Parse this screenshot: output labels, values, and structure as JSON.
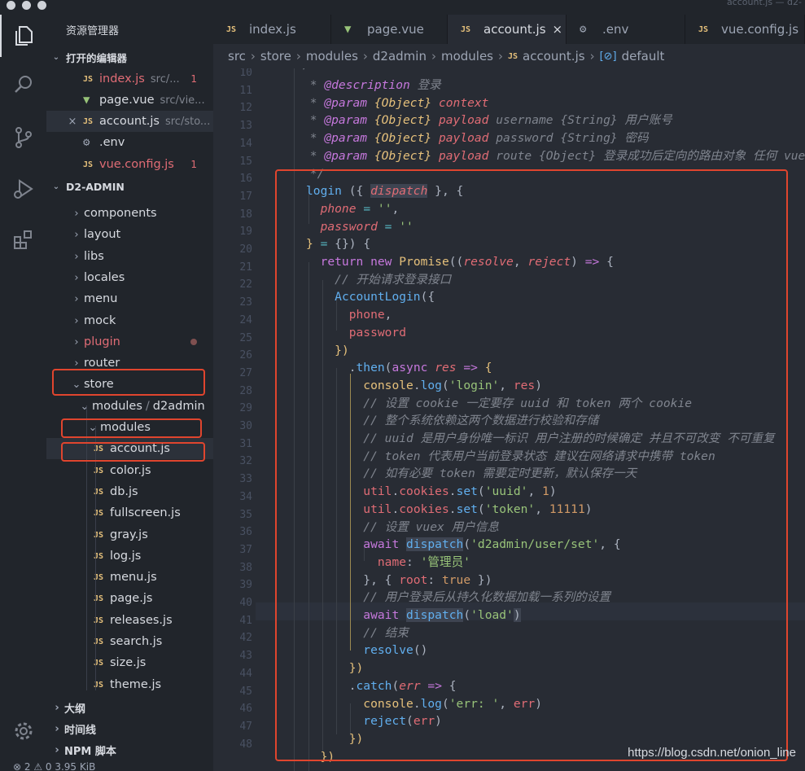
{
  "window": {
    "title": "account.js — d2-"
  },
  "activity_bar": {
    "items": [
      {
        "name": "explorer-icon"
      },
      {
        "name": "search-icon"
      },
      {
        "name": "source-control-icon"
      },
      {
        "name": "run-debug-icon"
      },
      {
        "name": "extensions-icon"
      },
      {
        "name": "settings-gear-icon"
      }
    ]
  },
  "sidebar": {
    "title": "资源管理器",
    "open_editors": {
      "label": "打开的编辑器",
      "files": [
        {
          "icon": "JS",
          "name": "index.js",
          "desc": "src/...",
          "badge": "1",
          "style": "mod"
        },
        {
          "icon": "V",
          "name": "page.vue",
          "desc": "src/vie...",
          "badge": "",
          "style": "normal"
        },
        {
          "icon": "JS",
          "name": "account.js",
          "desc": "src/sto...",
          "badge": "",
          "style": "normal",
          "close": "×"
        },
        {
          "icon": "gear",
          "name": ".env",
          "desc": "",
          "badge": "",
          "style": "normal"
        },
        {
          "icon": "JS",
          "name": "vue.config.js",
          "desc": "",
          "badge": "1",
          "style": "mod"
        }
      ]
    },
    "project": {
      "label": "D2-ADMIN",
      "folders_top": [
        "components",
        "layout",
        "libs",
        "locales",
        "menu",
        "mock",
        "plugin",
        "router"
      ],
      "store": "store",
      "modules_d2admin": {
        "a": "modules",
        "sep": "/",
        "b": "d2admin"
      },
      "modules": "modules",
      "files": [
        "account.js",
        "color.js",
        "db.js",
        "fullscreen.js",
        "gray.js",
        "log.js",
        "menu.js",
        "page.js",
        "releases.js",
        "search.js",
        "size.js",
        "theme.js"
      ]
    },
    "outline": "大纲",
    "timeline": "时间线",
    "npm": "NPM 脚本"
  },
  "status_bar": {
    "text": "⊗ 2  ⚠ 0     3.95 KiB"
  },
  "tabs": [
    {
      "icon": "JS",
      "label": "index.js",
      "active": false
    },
    {
      "icon": "V",
      "label": "page.vue",
      "active": false
    },
    {
      "icon": "JS",
      "label": "account.js",
      "active": true,
      "close": "×"
    },
    {
      "icon": "gear",
      "label": ".env",
      "active": false
    },
    {
      "icon": "JS",
      "label": "vue.config.js",
      "active": false
    }
  ],
  "breadcrumb": [
    "src",
    "store",
    "modules",
    "d2admin",
    "modules",
    "account.js",
    "default"
  ],
  "editor": {
    "line_numbers": [
      "10",
      "11",
      "12",
      "13",
      "14",
      "15",
      "16",
      "17",
      "18",
      "19",
      "20",
      "21",
      "22",
      "23",
      "24",
      "25",
      "26",
      "27",
      "28",
      "29",
      "30",
      "31",
      "32",
      "33",
      "34",
      "35",
      "36",
      "37",
      "38",
      "39",
      "40",
      "41",
      "42",
      "43",
      "44",
      "45",
      "46",
      "47",
      "48"
    ]
  },
  "watermark": "https://blog.csdn.net/onion_line",
  "colors": {
    "highlight_box": "#e0452e",
    "js_icon": "#e5c07b",
    "vue_icon": "#98c379"
  }
}
